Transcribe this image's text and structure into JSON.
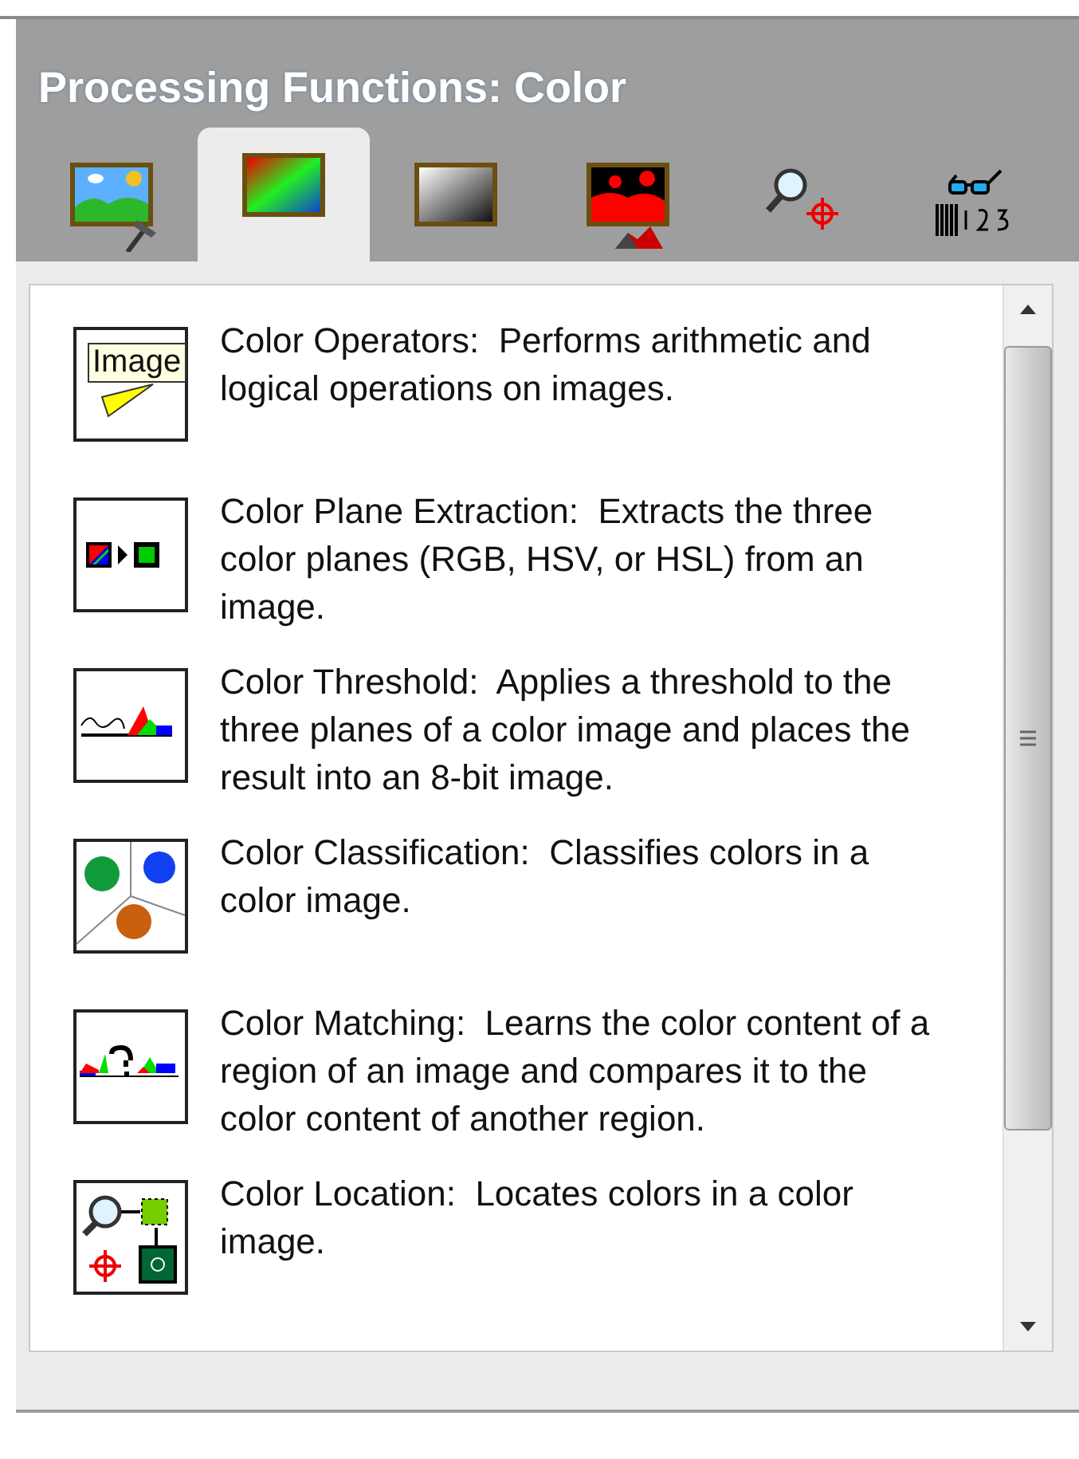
{
  "panel": {
    "title": "Processing Functions: Color"
  },
  "tabs": [
    {
      "selected": false
    },
    {
      "selected": true
    },
    {
      "selected": false
    },
    {
      "selected": false
    },
    {
      "selected": false
    },
    {
      "selected": false
    }
  ],
  "functions": [
    {
      "description": "Color Operators:  Performs arithmetic and logical operations on images.",
      "tooltip": "Image"
    },
    {
      "description": "Color Plane Extraction:  Extracts the three color planes (RGB, HSV, or HSL) from an image."
    },
    {
      "description": "Color Threshold:  Applies a threshold to the three planes of a color image and places the result into an 8-bit image."
    },
    {
      "description": "Color Classification:  Classifies colors in a color image."
    },
    {
      "description": "Color Matching:  Learns the color content of a region of an image and compares it to the color content of another region."
    },
    {
      "description": "Color Location:  Locates colors in a color image."
    }
  ]
}
